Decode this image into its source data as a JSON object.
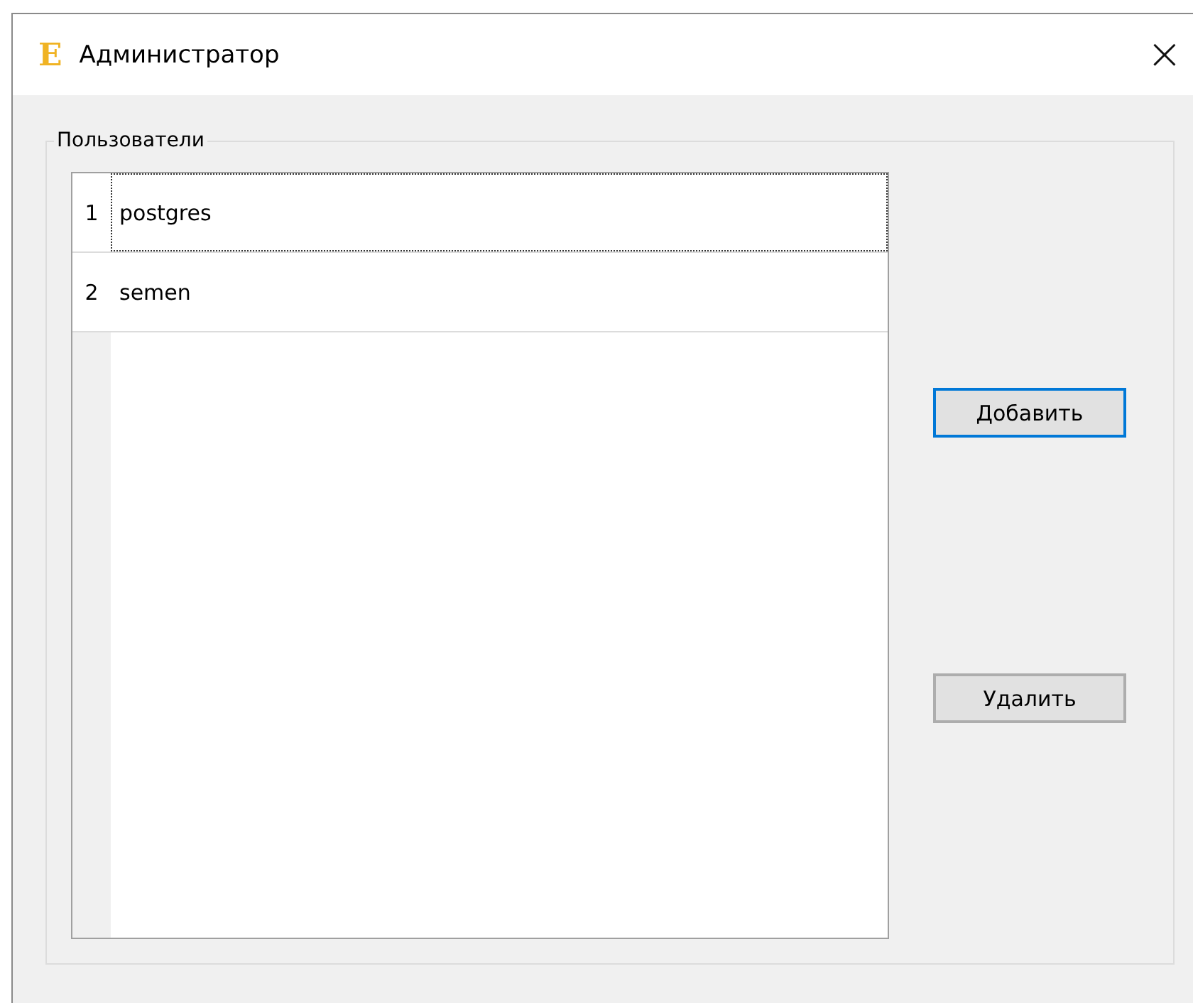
{
  "window": {
    "logo": "E",
    "title": "Администратор",
    "close": "×"
  },
  "group": {
    "title": "Пользователи"
  },
  "table": {
    "rows": [
      {
        "number": "1",
        "value": "postgres",
        "focused": true
      },
      {
        "number": "2",
        "value": "semen",
        "focused": false
      }
    ]
  },
  "buttons": [
    {
      "label": "Добавить",
      "focused": true
    },
    {
      "label": "Удалить",
      "focused": false
    }
  ]
}
